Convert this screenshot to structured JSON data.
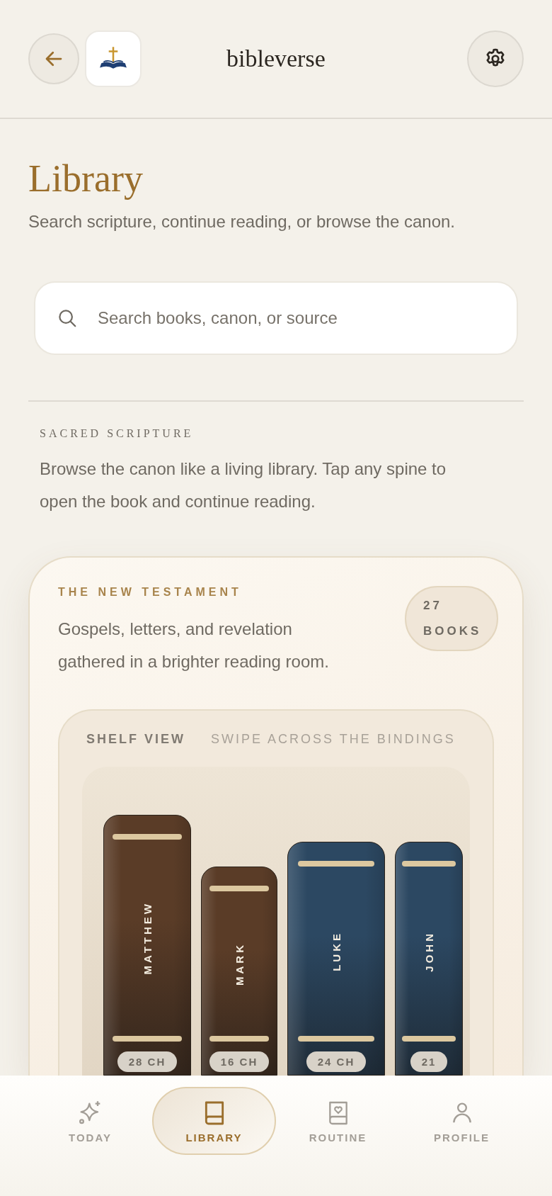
{
  "header": {
    "title": "bibleverse"
  },
  "page": {
    "title": "Library",
    "subtitle": "Search scripture, continue reading, or browse the canon."
  },
  "search": {
    "placeholder": "Search books, canon, or source"
  },
  "section": {
    "eyebrow": "SACRED SCRIPTURE",
    "description": "Browse the canon like a living library. Tap any spine to open the book and continue reading."
  },
  "testament": {
    "eyebrow": "THE NEW TESTAMENT",
    "description": "Gospels, letters, and revelation gathered in a brighter reading room.",
    "count": "27",
    "count_unit": "BOOKS",
    "shelf": {
      "label": "SHELF VIEW",
      "hint": "SWIPE ACROSS THE BINDINGS",
      "books": [
        {
          "name": "MATTHEW",
          "chapters": "28 CH",
          "color": "#5a3c27"
        },
        {
          "name": "MARK",
          "chapters": "16 CH",
          "color": "#5a3c27"
        },
        {
          "name": "LUKE",
          "chapters": "24 CH",
          "color": "#2c4862"
        },
        {
          "name": "JOHN",
          "chapters": "21",
          "color": "#2c4862"
        }
      ]
    }
  },
  "nav": [
    {
      "label": "TODAY",
      "kind": "sparkle",
      "selected": false
    },
    {
      "label": "LIBRARY",
      "kind": "book",
      "selected": true
    },
    {
      "label": "ROUTINE",
      "kind": "heart-book",
      "selected": false
    },
    {
      "label": "PROFILE",
      "kind": "person",
      "selected": false
    }
  ]
}
